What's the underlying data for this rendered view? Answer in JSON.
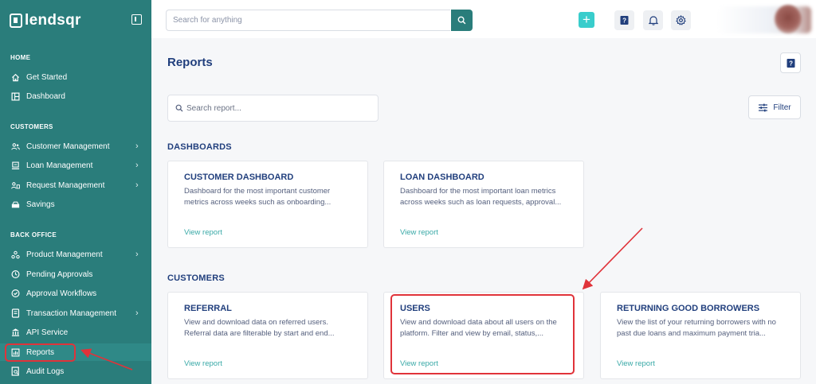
{
  "app": {
    "brand": "lendsqr"
  },
  "sidebar": {
    "sections": {
      "home": "HOME",
      "customers": "CUSTOMERS",
      "back_office": "BACK OFFICE"
    },
    "items": [
      {
        "label": "Get Started",
        "icon": "home-icon"
      },
      {
        "label": "Dashboard",
        "icon": "dashboard-icon"
      },
      {
        "label": "Customer Management",
        "icon": "users-icon"
      },
      {
        "label": "Loan Management",
        "icon": "loan-icon"
      },
      {
        "label": "Request Management",
        "icon": "request-icon"
      },
      {
        "label": "Savings",
        "icon": "savings-icon"
      },
      {
        "label": "Product Management",
        "icon": "product-icon"
      },
      {
        "label": "Pending Approvals",
        "icon": "clock-icon"
      },
      {
        "label": "Approval Workflows",
        "icon": "workflow-icon"
      },
      {
        "label": "Transaction Management",
        "icon": "transaction-icon"
      },
      {
        "label": "API Service",
        "icon": "bank-icon"
      },
      {
        "label": "Reports",
        "icon": "chart-icon"
      },
      {
        "label": "Audit Logs",
        "icon": "audit-icon"
      }
    ]
  },
  "topbar": {
    "search_placeholder": "Search for anything",
    "plus_label": "+"
  },
  "main": {
    "title": "Reports",
    "search_placeholder": "Search report...",
    "filter_label": "Filter",
    "dashboards_heading": "DASHBOARDS",
    "customers_heading": "CUSTOMERS",
    "dashboard_cards": [
      {
        "title": "CUSTOMER DASHBOARD",
        "description": "Dashboard for the most important customer metrics across weeks such as onboarding...",
        "link": "View report"
      },
      {
        "title": "LOAN DASHBOARD",
        "description": "Dashboard for the most important loan metrics across weeks such as loan requests, approval...",
        "link": "View report"
      }
    ],
    "customer_cards": [
      {
        "title": "REFERRAL",
        "description": "View and download data on referred users. Referral data are filterable by start and end...",
        "link": "View report"
      },
      {
        "title": "USERS",
        "description": "View and download data about all users on the platform. Filter and view by email, status,...",
        "link": "View report"
      },
      {
        "title": "RETURNING GOOD BORROWERS",
        "description": "View the list of your returning borrowers with no past due loans and maximum payment tria...",
        "link": "View report"
      }
    ]
  },
  "colors": {
    "sidebar": "#2a7d7b",
    "accent": "#39cdcc",
    "title": "#213f7d",
    "annotation": "#e0333a"
  }
}
